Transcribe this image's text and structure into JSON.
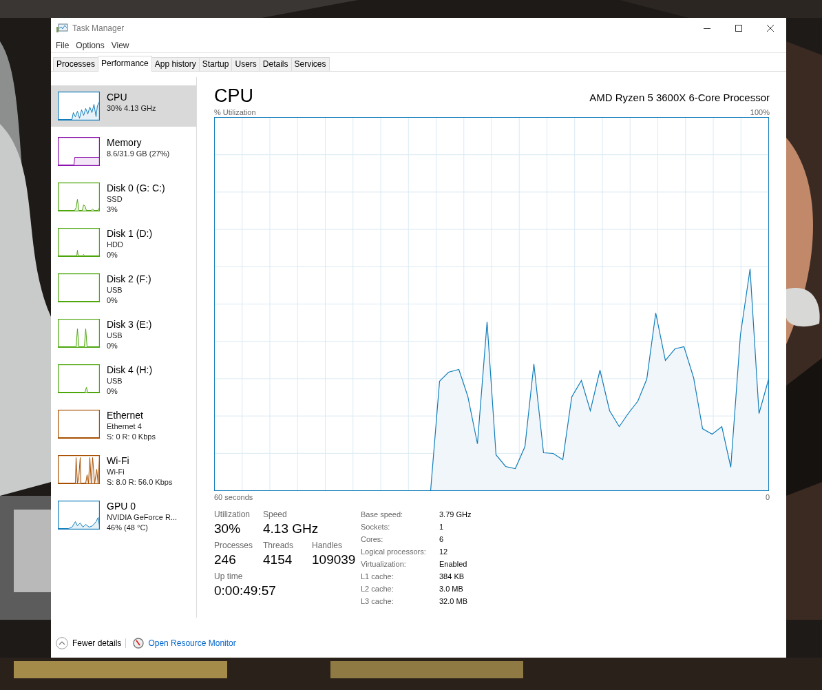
{
  "window": {
    "title": "Task Manager"
  },
  "menu": [
    "File",
    "Options",
    "View"
  ],
  "tabs": [
    {
      "label": "Processes",
      "selected": false
    },
    {
      "label": "Performance",
      "selected": true
    },
    {
      "label": "App history",
      "selected": false
    },
    {
      "label": "Startup",
      "selected": false
    },
    {
      "label": "Users",
      "selected": false
    },
    {
      "label": "Details",
      "selected": false
    },
    {
      "label": "Services",
      "selected": false
    }
  ],
  "sidebar": {
    "items": [
      {
        "name": "CPU",
        "lines": [
          "30% 4.13 GHz"
        ],
        "color": "#117dbb",
        "selected": true
      },
      {
        "name": "Memory",
        "lines": [
          "8.6/31.9 GB (27%)"
        ],
        "color": "#8b12ae",
        "selected": false
      },
      {
        "name": "Disk 0 (G: C:)",
        "lines": [
          "SSD",
          "3%"
        ],
        "color": "#4da60c",
        "selected": false
      },
      {
        "name": "Disk 1 (D:)",
        "lines": [
          "HDD",
          "0%"
        ],
        "color": "#4da60c",
        "selected": false
      },
      {
        "name": "Disk 2 (F:)",
        "lines": [
          "USB",
          "0%"
        ],
        "color": "#4da60c",
        "selected": false
      },
      {
        "name": "Disk 3 (E:)",
        "lines": [
          "USB",
          "0%"
        ],
        "color": "#4da60c",
        "selected": false
      },
      {
        "name": "Disk 4 (H:)",
        "lines": [
          "USB",
          "0%"
        ],
        "color": "#4da60c",
        "selected": false
      },
      {
        "name": "Ethernet",
        "lines": [
          "Ethernet 4",
          "S: 0 R: 0 Kbps"
        ],
        "color": "#a74f01",
        "selected": false
      },
      {
        "name": "Wi-Fi",
        "lines": [
          "Wi-Fi",
          "S: 8.0 R: 56.0 Kbps"
        ],
        "color": "#a74f01",
        "selected": false
      },
      {
        "name": "GPU 0",
        "lines": [
          "NVIDIA GeForce R...",
          "46% (48 °C)"
        ],
        "color": "#117dbb",
        "selected": false
      }
    ]
  },
  "main": {
    "title": "CPU",
    "processor": "AMD Ryzen 5 3600X 6-Core Processor",
    "graph": {
      "ylabel": "% Utilization",
      "ymax_label": "100%",
      "xstart_label": "60 seconds",
      "xend_label": "0"
    },
    "stat_rows": [
      [
        {
          "label": "Utilization",
          "value": "30%"
        },
        {
          "label": "Speed",
          "value": "4.13 GHz"
        }
      ],
      [
        {
          "label": "Processes",
          "value": "246"
        },
        {
          "label": "Threads",
          "value": "4154"
        },
        {
          "label": "Handles",
          "value": "109039"
        }
      ],
      [
        {
          "label": "Up time",
          "value": "0:00:49:57"
        }
      ]
    ],
    "details": [
      {
        "label": "Base speed:",
        "value": "3.79 GHz"
      },
      {
        "label": "Sockets:",
        "value": "1"
      },
      {
        "label": "Cores:",
        "value": "6"
      },
      {
        "label": "Logical processors:",
        "value": "12"
      },
      {
        "label": "Virtualization:",
        "value": "Enabled"
      },
      {
        "label": "L1 cache:",
        "value": "384 KB"
      },
      {
        "label": "L2 cache:",
        "value": "3.0 MB"
      },
      {
        "label": "L3 cache:",
        "value": "32.0 MB"
      }
    ]
  },
  "footer": {
    "fewer_details": "Fewer details",
    "resource_monitor": "Open Resource Monitor"
  }
}
